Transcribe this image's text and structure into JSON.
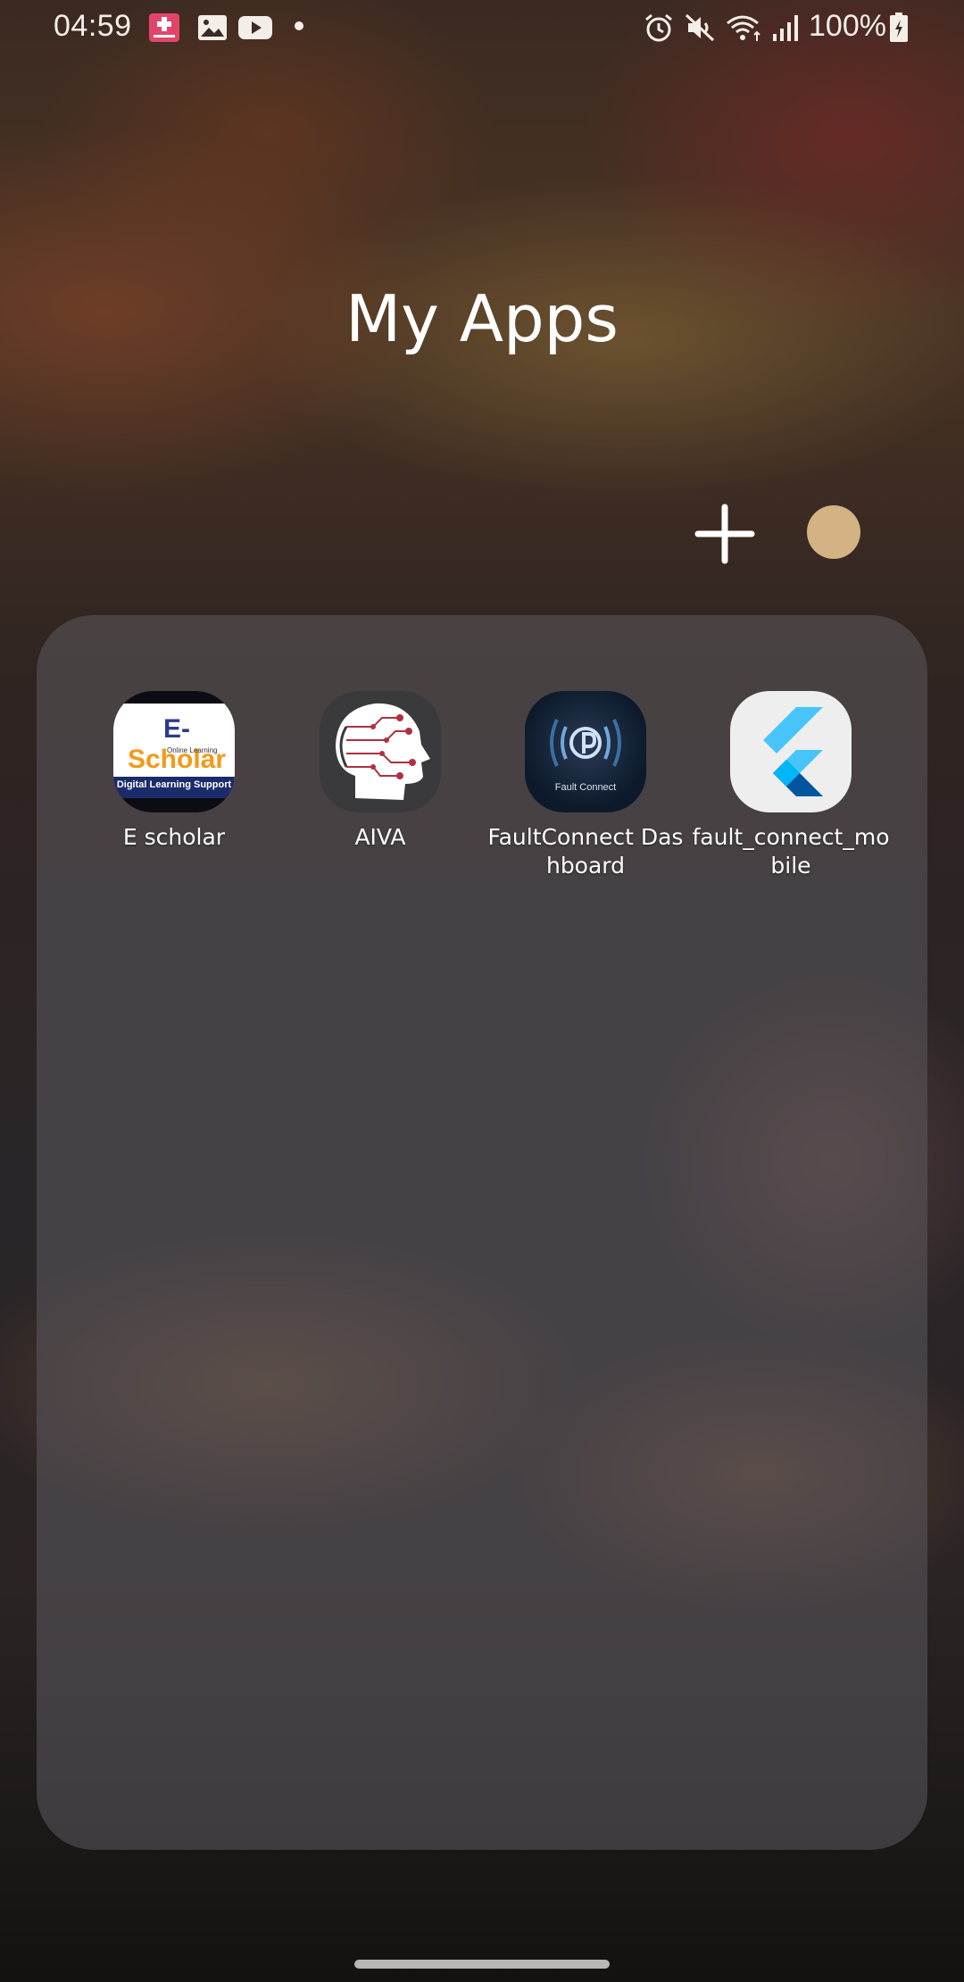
{
  "status_bar": {
    "time": "04:59",
    "battery": "100%",
    "left_icons": [
      "news-icon",
      "gallery-icon",
      "youtube-icon",
      "dot-icon"
    ],
    "right_icons": [
      "alarm-icon",
      "mute-icon",
      "wifi-icon",
      "signal-icon",
      "battery-icon"
    ]
  },
  "folder": {
    "title": "My Apps",
    "color": "#d3b283",
    "apps": [
      {
        "label": "E scholar",
        "icon": "escholar-icon"
      },
      {
        "label": "AIVA",
        "icon": "aiva-icon"
      },
      {
        "label": "FaultConnect Dashboard",
        "icon": "faultconnect-icon"
      },
      {
        "label": "fault_connect_mobile",
        "icon": "flutter-icon"
      }
    ]
  },
  "icon_text": {
    "escholar_logo_e": "E-",
    "escholar_logo": "Scholar",
    "escholar_online": "Online Learning",
    "escholar_sub": "Digital Learning Support",
    "faultconnect_caption": "Fault Connect"
  }
}
